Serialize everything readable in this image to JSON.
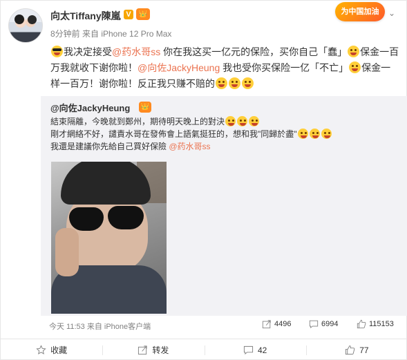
{
  "header": {
    "username": "向太Tiffany陳嵐",
    "verified_mark": "V",
    "level_badge": "👑",
    "meta": "8分钟前 来自 iPhone 12 Pro Max",
    "promo": "为中国加油"
  },
  "post": {
    "seg1": "我决定接受",
    "mention1": "@药水哥ss",
    "seg2": " 你在我这买一亿元的保险，买你自己「蠢」",
    "seg3": "保金一百万我就收下谢你啦！",
    "mention2": "@向佐JackyHeung",
    "seg4": " 我也受你买保险一亿「不亡」",
    "seg5": "保金一样一百万！谢你啦！反正我只赚不赔的"
  },
  "retweet": {
    "username": "@向佐JackyHeung",
    "line1": "結束隔離，今晚就到鄭州，期待明天晚上的對決",
    "line2": "剛才網絡不好，譴責水哥在發佈會上語氣挺狂的，想和我\"同歸於盡\"",
    "line3_text": "我還是建議你先給自己買好保險 ",
    "line3_mention": "@药水哥ss",
    "time": "今天 11:53 来自 iPhone客户端",
    "reposts": "4496",
    "comments": "6994",
    "likes": "115153"
  },
  "toolbar": {
    "favorite": "收藏",
    "repost": "转发",
    "comment": "42",
    "like": "77"
  },
  "colors": {
    "accent": "#eb7350",
    "verified": "#f7a600",
    "retweet_bg": "#f2f2f5"
  }
}
